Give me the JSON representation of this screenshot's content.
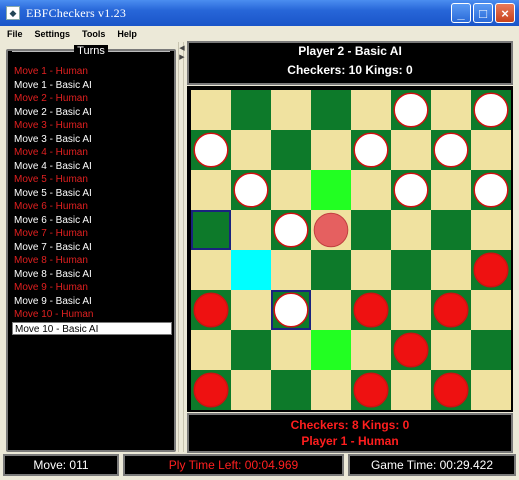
{
  "window": {
    "title": "EBFCheckers v1.23",
    "minimize_glyph": "_",
    "maximize_glyph": "□",
    "close_glyph": "×",
    "icon_name": "checkers-app-icon"
  },
  "menu": {
    "items": [
      "File",
      "Settings",
      "Tools",
      "Help"
    ]
  },
  "turns": {
    "title": "Turns",
    "moves": [
      {
        "label": "Move 1 - Human",
        "player": "human"
      },
      {
        "label": "Move 1 - Basic AI",
        "player": "ai"
      },
      {
        "label": "Move 2 - Human",
        "player": "human"
      },
      {
        "label": "Move 2 - Basic AI",
        "player": "ai"
      },
      {
        "label": "Move 3 - Human",
        "player": "human"
      },
      {
        "label": "Move 3 - Basic AI",
        "player": "ai"
      },
      {
        "label": "Move 4 - Human",
        "player": "human"
      },
      {
        "label": "Move 4 - Basic AI",
        "player": "ai"
      },
      {
        "label": "Move 5 - Human",
        "player": "human"
      },
      {
        "label": "Move 5 - Basic AI",
        "player": "ai"
      },
      {
        "label": "Move 6 - Human",
        "player": "human"
      },
      {
        "label": "Move 6 - Basic AI",
        "player": "ai"
      },
      {
        "label": "Move 7 - Human",
        "player": "human"
      },
      {
        "label": "Move 7 - Basic AI",
        "player": "ai"
      },
      {
        "label": "Move 8 - Human",
        "player": "human"
      },
      {
        "label": "Move 8 - Basic AI",
        "player": "ai"
      },
      {
        "label": "Move 9 - Human",
        "player": "human"
      },
      {
        "label": "Move 9 - Basic AI",
        "player": "ai"
      },
      {
        "label": "Move 10 - Human",
        "player": "human"
      },
      {
        "label": "Move 10 - Basic AI",
        "player": "ai",
        "selected": true
      }
    ]
  },
  "player2": {
    "name": "Player 2 - Basic AI",
    "counts": "Checkers: 10   Kings: 0"
  },
  "player1": {
    "counts": "Checkers: 8   Kings: 0",
    "name": "Player 1 - Human"
  },
  "status": {
    "move": "Move: 011",
    "ply_time": "Ply Time Left: 00:04.969",
    "game_time": "Game Time: 00:29.422"
  },
  "board": {
    "rows": 8,
    "cols": 8,
    "colors": {
      "light": "#f0e2a0",
      "dark": "#0d7a2a",
      "white_piece": "#ffffff",
      "red_piece": "#ee1111",
      "piece_outline": "#d01010",
      "highlight_green": "#22ff22",
      "highlight_cyan": "#00ffff",
      "selected_border": "#1a237e",
      "ghost_piece": "#e56060"
    },
    "pieces": [
      {
        "row": 0,
        "col": 5,
        "color": "white"
      },
      {
        "row": 0,
        "col": 7,
        "color": "white"
      },
      {
        "row": 1,
        "col": 0,
        "color": "white"
      },
      {
        "row": 1,
        "col": 4,
        "color": "white"
      },
      {
        "row": 1,
        "col": 6,
        "color": "white"
      },
      {
        "row": 2,
        "col": 1,
        "color": "white"
      },
      {
        "row": 2,
        "col": 5,
        "color": "white"
      },
      {
        "row": 2,
        "col": 7,
        "color": "white"
      },
      {
        "row": 3,
        "col": 2,
        "color": "white"
      },
      {
        "row": 5,
        "col": 2,
        "color": "white"
      },
      {
        "row": 4,
        "col": 7,
        "color": "red"
      },
      {
        "row": 5,
        "col": 0,
        "color": "red"
      },
      {
        "row": 5,
        "col": 4,
        "color": "red"
      },
      {
        "row": 5,
        "col": 6,
        "color": "red"
      },
      {
        "row": 6,
        "col": 5,
        "color": "red"
      },
      {
        "row": 7,
        "col": 0,
        "color": "red"
      },
      {
        "row": 7,
        "col": 4,
        "color": "red"
      },
      {
        "row": 7,
        "col": 6,
        "color": "red"
      }
    ],
    "ghost_piece": {
      "row": 3,
      "col": 3
    },
    "highlights": [
      {
        "row": 2,
        "col": 3,
        "type": "green"
      },
      {
        "row": 6,
        "col": 3,
        "type": "green"
      },
      {
        "row": 4,
        "col": 1,
        "type": "cyan"
      }
    ],
    "outlined_squares": [
      {
        "row": 3,
        "col": 0
      },
      {
        "row": 5,
        "col": 2
      }
    ]
  }
}
